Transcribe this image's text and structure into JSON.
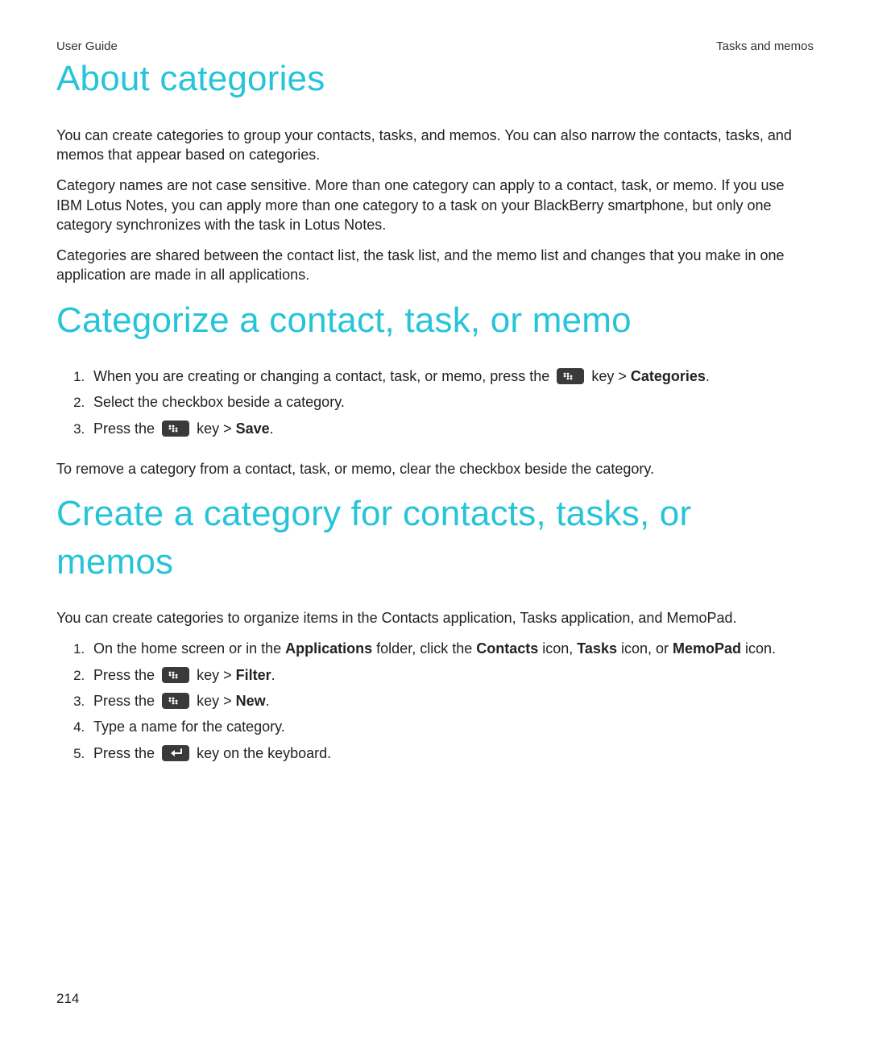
{
  "header": {
    "left": "User Guide",
    "right": "Tasks and memos"
  },
  "sections": {
    "about": {
      "heading": "About categories",
      "p1": "You can create categories to group your contacts, tasks, and memos. You can also narrow the contacts, tasks, and memos that appear based on categories.",
      "p2": "Category names are not case sensitive. More than one category can apply to a contact, task, or memo. If you use IBM Lotus Notes, you can apply more than one category to a task on your BlackBerry smartphone, but only one category synchronizes with the task in Lotus Notes.",
      "p3": "Categories are shared between the contact list, the task list, and the memo list and changes that you make in one application are made in all applications."
    },
    "categorize": {
      "heading": "Categorize a contact, task, or memo",
      "steps": {
        "s1_a": "When you are creating or changing a contact, task, or memo, press the ",
        "s1_b": " key > ",
        "s1_c": "Categories",
        "s1_d": ".",
        "s2": "Select the checkbox beside a category.",
        "s3_a": "Press the ",
        "s3_b": " key > ",
        "s3_c": "Save",
        "s3_d": "."
      },
      "note": "To remove a category from a contact, task, or memo, clear the checkbox beside the category."
    },
    "create": {
      "heading": "Create a category for contacts, tasks, or memos",
      "intro": "You can create categories to organize items in the Contacts application, Tasks application, and MemoPad.",
      "steps": {
        "s1_a": "On the home screen or in the ",
        "s1_b": "Applications",
        "s1_c": " folder, click the ",
        "s1_d": "Contacts",
        "s1_e": " icon, ",
        "s1_f": "Tasks",
        "s1_g": " icon, or ",
        "s1_h": "MemoPad",
        "s1_i": " icon.",
        "s2_a": "Press the ",
        "s2_b": " key > ",
        "s2_c": "Filter",
        "s2_d": ".",
        "s3_a": "Press the ",
        "s3_b": " key > ",
        "s3_c": "New",
        "s3_d": ".",
        "s4": "Type a name for the category.",
        "s5_a": "Press the ",
        "s5_b": " key on the keyboard."
      }
    }
  },
  "page_number": "214"
}
